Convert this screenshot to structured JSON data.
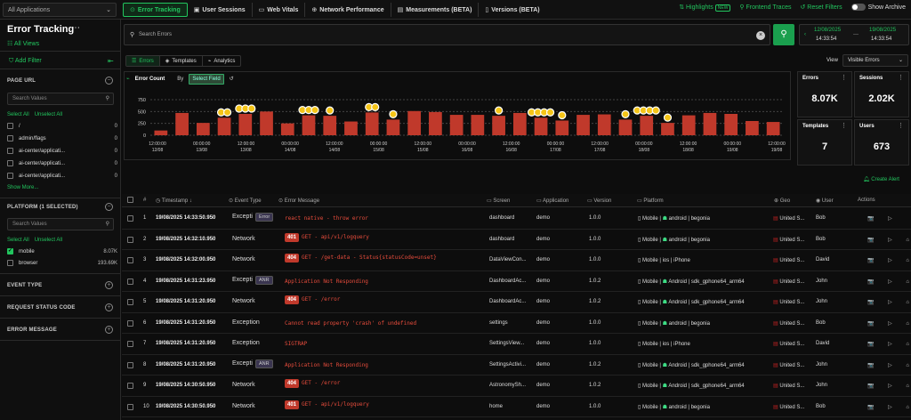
{
  "topbar": {
    "app_select": "All Applications",
    "tabs": [
      {
        "label": "Error Tracking",
        "icon": "error-tracking-icon",
        "active": true
      },
      {
        "label": "User Sessions",
        "icon": "user-sessions-icon",
        "active": false
      },
      {
        "label": "Web Vitals",
        "icon": "web-vitals-icon",
        "active": false
      },
      {
        "label": "Network Performance",
        "icon": "network-icon",
        "active": false
      },
      {
        "label": "Measurements (BETA)",
        "icon": "measurements-icon",
        "active": false
      },
      {
        "label": "Versions (BETA)",
        "icon": "versions-icon",
        "active": false
      }
    ],
    "highlights": "Highlights",
    "new_badge": "NEW",
    "frontend_traces": "Frontend Traces",
    "reset_filters": "Reset Filters",
    "show_archive": "Show Archive"
  },
  "sidebar": {
    "title": "Error Tracking",
    "all_views": "All Views",
    "add_filter": "Add Filter",
    "page_url": {
      "heading": "PAGE URL",
      "placeholder": "Search Values",
      "select_all": "Select All",
      "unselect_all": "Unselect All",
      "items": [
        {
          "label": "/",
          "count": "0"
        },
        {
          "label": "admin/flags",
          "count": "0"
        },
        {
          "label": "ai-center/applicati...",
          "count": "0"
        },
        {
          "label": "ai-center/applicati...",
          "count": "0"
        },
        {
          "label": "ai-center/applicati...",
          "count": "0"
        }
      ],
      "show_more": "Show More..."
    },
    "platform": {
      "heading": "PLATFORM (1 SELECTED)",
      "placeholder": "Search Values",
      "select_all": "Select All",
      "unselect_all": "Unselect All",
      "items": [
        {
          "label": "mobile",
          "count": "8.07K",
          "checked": true
        },
        {
          "label": "browser",
          "count": "193.69K",
          "checked": false
        }
      ]
    },
    "sections": [
      "EVENT TYPE",
      "REQUEST STATUS CODE",
      "ERROR MESSAGE"
    ]
  },
  "search": {
    "placeholder": "Search Errors",
    "date_from": "12/08/2025",
    "time_from": "14:33:54",
    "date_to": "19/08/2025",
    "time_to": "14:33:54"
  },
  "subtabs": [
    {
      "label": "Errors",
      "active": true
    },
    {
      "label": "Templates",
      "active": false
    },
    {
      "label": "Analytics",
      "active": false
    }
  ],
  "view": {
    "label": "View",
    "value": "Visible Errors"
  },
  "chart": {
    "title": "Error Count",
    "by_label": "By",
    "select_field": "Select Field"
  },
  "chart_data": {
    "type": "bar",
    "yticks": [
      "750",
      "500",
      "250",
      "0"
    ],
    "ylim": [
      0,
      750
    ],
    "values": [
      100,
      470,
      260,
      370,
      450,
      500,
      250,
      420,
      410,
      290,
      480,
      330,
      510,
      490,
      430,
      430,
      410,
      470,
      370,
      310,
      430,
      440,
      330,
      410,
      260,
      420,
      470,
      450,
      300,
      280
    ],
    "x_labels": [
      {
        "time": "12:00:00",
        "date": "12/08"
      },
      {
        "time": "00:00:00",
        "date": "13/08"
      },
      {
        "time": "12:00:00",
        "date": "13/08"
      },
      {
        "time": "00:00:00",
        "date": "14/08"
      },
      {
        "time": "12:00:00",
        "date": "14/08"
      },
      {
        "time": "00:00:00",
        "date": "15/08"
      },
      {
        "time": "12:00:00",
        "date": "15/08"
      },
      {
        "time": "00:00:00",
        "date": "16/08"
      },
      {
        "time": "12:00:00",
        "date": "16/08"
      },
      {
        "time": "00:00:00",
        "date": "17/08"
      },
      {
        "time": "12:00:00",
        "date": "17/08"
      },
      {
        "time": "00:00:00",
        "date": "18/08"
      },
      {
        "time": "12:00:00",
        "date": "18/08"
      },
      {
        "time": "00:00:00",
        "date": "19/08"
      },
      {
        "time": "12:00:00",
        "date": "19/08"
      }
    ],
    "markers": [
      {
        "bar": 3,
        "count": 2
      },
      {
        "bar": 4,
        "count": 3
      },
      {
        "bar": 7,
        "count": 3
      },
      {
        "bar": 8,
        "count": 1
      },
      {
        "bar": 10,
        "count": 2
      },
      {
        "bar": 11,
        "count": 1
      },
      {
        "bar": 16,
        "count": 1
      },
      {
        "bar": 18,
        "count": 4
      },
      {
        "bar": 19,
        "count": 1
      },
      {
        "bar": 22,
        "count": 1
      },
      {
        "bar": 23,
        "count": 4
      },
      {
        "bar": 24,
        "count": 1
      }
    ],
    "colors": {
      "bar": "#c0392b",
      "marker": "#f5c518"
    }
  },
  "stats": [
    {
      "label": "Errors",
      "value": "8.07K"
    },
    {
      "label": "Sessions",
      "value": "2.02K"
    },
    {
      "label": "Templates",
      "value": "7"
    },
    {
      "label": "Users",
      "value": "673"
    }
  ],
  "create_alert": "Create Alert",
  "table": {
    "headers": {
      "num": "#",
      "timestamp": "Timestamp",
      "event_type": "Event Type",
      "message": "Error Message",
      "screen": "Screen",
      "application": "Application",
      "version": "Version",
      "platform": "Platform",
      "geo": "Geo",
      "user": "User",
      "actions": "Actions"
    },
    "rows": [
      {
        "num": "1",
        "timestamp": "19/08/2025 14:33:50.950",
        "event": "Excepti",
        "tag": "Error",
        "code": "",
        "message": "react native - throw error",
        "screen": "dashboard",
        "app": "demo",
        "version": "1.0.0",
        "plat": "Mobile",
        "os": "android",
        "device": "begonia",
        "os_icon": "android",
        "geo": "United S...",
        "user": "Bob",
        "actions": "📷 ▷"
      },
      {
        "num": "2",
        "timestamp": "19/08/2025 14:32:10.950",
        "event": "Network",
        "tag": "",
        "code": "401",
        "message": "GET - api/v1/logquery",
        "screen": "dashboard",
        "app": "demo",
        "version": "1.0.0",
        "plat": "Mobile",
        "os": "android",
        "device": "begonia",
        "os_icon": "android",
        "geo": "United S...",
        "user": "Bob",
        "actions": "📷 ▷ ⌂"
      },
      {
        "num": "3",
        "timestamp": "19/08/2025 14:32:00.950",
        "event": "Network",
        "tag": "",
        "code": "404",
        "message": "GET - /get-data - Status{statusCode=unset}",
        "screen": "DataViewCon...",
        "app": "demo",
        "version": "1.0.0",
        "plat": "Mobile",
        "os": "ios",
        "device": "iPhone",
        "os_icon": "apple",
        "geo": "United S...",
        "user": "David",
        "actions": "📷 ▷ ⌂"
      },
      {
        "num": "4",
        "timestamp": "19/08/2025 14:31:23.950",
        "event": "Excepti",
        "tag": "ANR",
        "code": "",
        "message": "Application Not Responding",
        "screen": "DashboardAc...",
        "app": "demo",
        "version": "1.0.2",
        "plat": "Mobile",
        "os": "Android",
        "device": "sdk_gphone64_arm64",
        "os_icon": "android",
        "geo": "United S...",
        "user": "John",
        "actions": "📷 ▷ ⌂"
      },
      {
        "num": "5",
        "timestamp": "19/08/2025 14:31:20.950",
        "event": "Network",
        "tag": "",
        "code": "404",
        "message": "GET - /error",
        "screen": "DashboardAc...",
        "app": "demo",
        "version": "1.0.2",
        "plat": "Mobile",
        "os": "Android",
        "device": "sdk_gphone64_arm64",
        "os_icon": "android",
        "geo": "United S...",
        "user": "John",
        "actions": "📷 ▷ ⌂"
      },
      {
        "num": "6",
        "timestamp": "19/08/2025 14:31:20.950",
        "event": "Exception",
        "tag": "",
        "code": "",
        "message": "Cannot read property 'crash' of undefined",
        "screen": "settings",
        "app": "demo",
        "version": "1.0.0",
        "plat": "Mobile",
        "os": "android",
        "device": "begonia",
        "os_icon": "android",
        "geo": "United S...",
        "user": "Bob",
        "actions": "📷 ▷ ⌂"
      },
      {
        "num": "7",
        "timestamp": "19/08/2025 14:31:20.950",
        "event": "Exception",
        "tag": "",
        "code": "",
        "message": "SIGTRAP",
        "screen": "SettingsView...",
        "app": "demo",
        "version": "1.0.0",
        "plat": "Mobile",
        "os": "ios",
        "device": "iPhone",
        "os_icon": "apple",
        "geo": "United S...",
        "user": "David",
        "actions": "📷 ▷ ⌂"
      },
      {
        "num": "8",
        "timestamp": "19/08/2025 14:31:20.950",
        "event": "Excepti",
        "tag": "ANR",
        "code": "",
        "message": "Application Not Responding",
        "screen": "SettingsActivi...",
        "app": "demo",
        "version": "1.0.2",
        "plat": "Mobile",
        "os": "Android",
        "device": "sdk_gphone64_arm64",
        "os_icon": "android",
        "geo": "United S...",
        "user": "John",
        "actions": "📷 ▷ ⌂"
      },
      {
        "num": "9",
        "timestamp": "19/08/2025 14:30:50.950",
        "event": "Network",
        "tag": "",
        "code": "404",
        "message": "GET - /error",
        "screen": "AstronomySh...",
        "app": "demo",
        "version": "1.0.2",
        "plat": "Mobile",
        "os": "Android",
        "device": "sdk_gphone64_arm64",
        "os_icon": "android",
        "geo": "United S...",
        "user": "John",
        "actions": "📷 ▷ ⌂"
      },
      {
        "num": "10",
        "timestamp": "19/08/2025 14:30:50.950",
        "event": "Network",
        "tag": "",
        "code": "401",
        "message": "GET - api/v1/logquery",
        "screen": "home",
        "app": "demo",
        "version": "1.0.0",
        "plat": "Mobile",
        "os": "android",
        "device": "begonia",
        "os_icon": "android",
        "geo": "United S...",
        "user": "Bob",
        "actions": "📷 ▷ ⌂"
      }
    ]
  }
}
